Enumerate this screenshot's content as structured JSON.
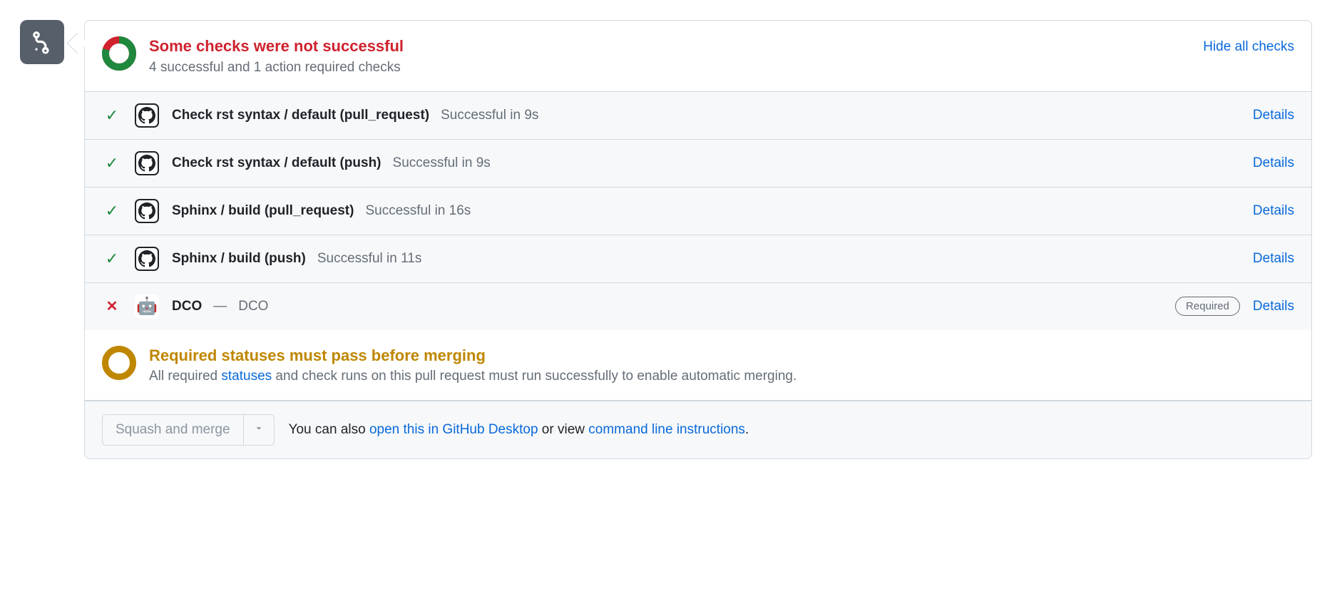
{
  "header": {
    "title": "Some checks were not successful",
    "subtitle": "4 successful and 1 action required checks",
    "hide_link": "Hide all checks",
    "donut": {
      "success_fraction": 0.8
    }
  },
  "checks": [
    {
      "status": "success",
      "avatar": "github",
      "name": "Check rst syntax / default (pull_request)",
      "detail": "Successful in 9s",
      "required": false,
      "details_label": "Details"
    },
    {
      "status": "success",
      "avatar": "github",
      "name": "Check rst syntax / default (push)",
      "detail": "Successful in 9s",
      "required": false,
      "details_label": "Details"
    },
    {
      "status": "success",
      "avatar": "github",
      "name": "Sphinx / build (pull_request)",
      "detail": "Successful in 16s",
      "required": false,
      "details_label": "Details"
    },
    {
      "status": "success",
      "avatar": "github",
      "name": "Sphinx / build (push)",
      "detail": "Successful in 11s",
      "required": false,
      "details_label": "Details"
    },
    {
      "status": "fail",
      "avatar": "bot",
      "name": "DCO",
      "dash": "—",
      "detail": "DCO",
      "required": true,
      "required_label": "Required",
      "details_label": "Details"
    }
  ],
  "required_block": {
    "title": "Required statuses must pass before merging",
    "sub_prefix": "All required ",
    "statuses_link": "statuses",
    "sub_suffix": " and check runs on this pull request must run successfully to enable automatic merging."
  },
  "footer": {
    "merge_button": "Squash and merge",
    "text_prefix": "You can also ",
    "link_desktop": "open this in GitHub Desktop",
    "text_mid": " or view ",
    "link_cli": "command line instructions",
    "text_suffix": "."
  }
}
